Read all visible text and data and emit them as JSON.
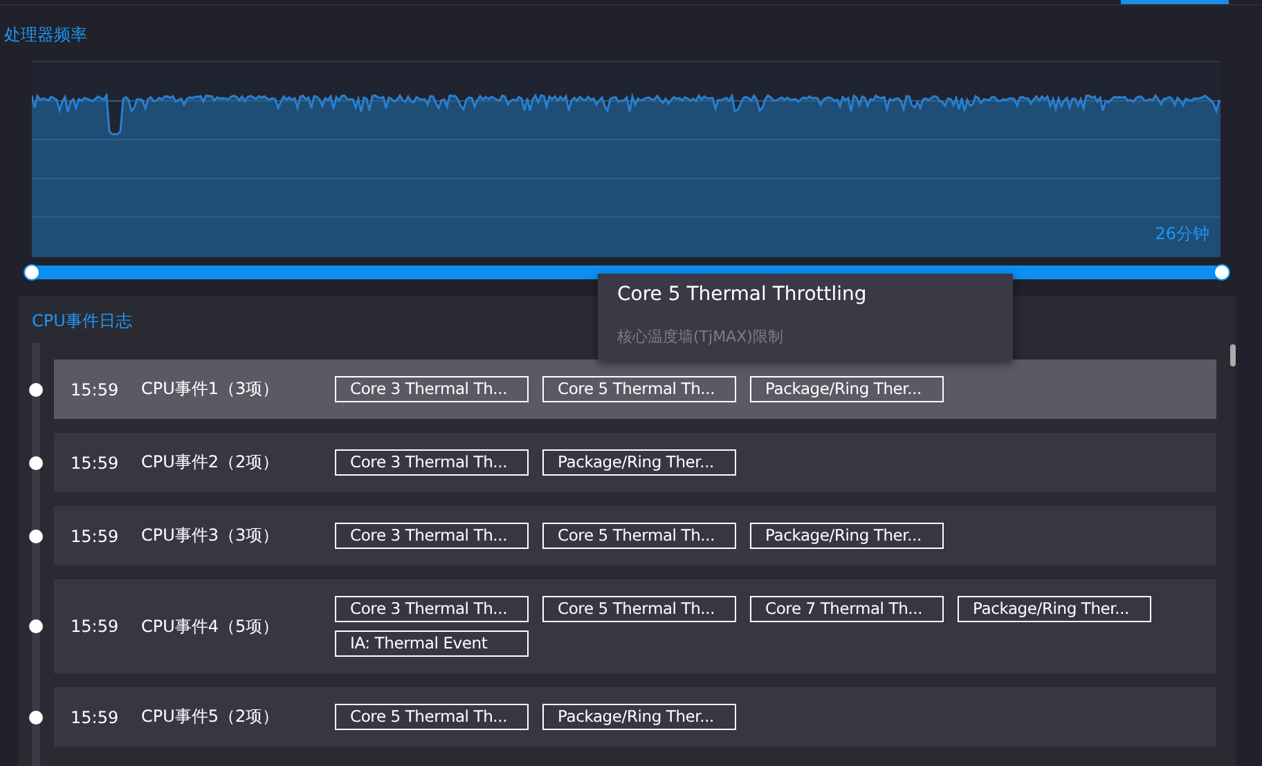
{
  "header": {
    "tab_indicator": true
  },
  "frequency": {
    "title": "处理器频率",
    "time_label": "26分钟",
    "range": {
      "level": 1
    }
  },
  "event_log": {
    "title": "CPU事件日志",
    "events": [
      {
        "time": "15:59",
        "name": "CPU事件1（3项）",
        "selected": true,
        "tags": [
          "Core 3 Thermal Th...",
          "Core 5 Thermal Th...",
          "Package/Ring Ther..."
        ]
      },
      {
        "time": "15:59",
        "name": "CPU事件2（2项）",
        "selected": false,
        "tags": [
          "Core 3 Thermal Th...",
          "Package/Ring Ther..."
        ]
      },
      {
        "time": "15:59",
        "name": "CPU事件3（3项）",
        "selected": false,
        "tags": [
          "Core 3 Thermal Th...",
          "Core 5 Thermal Th...",
          "Package/Ring Ther..."
        ]
      },
      {
        "time": "15:59",
        "name": "CPU事件4（5项）",
        "selected": false,
        "tags": [
          "Core 3 Thermal Th...",
          "Core 5 Thermal Th...",
          "Core 7 Thermal Th...",
          "Package/Ring Ther...",
          "IA: Thermal Event"
        ]
      },
      {
        "time": "15:59",
        "name": "CPU事件5（2项）",
        "selected": false,
        "tags": [
          "Core 5 Thermal Th...",
          "Package/Ring Ther..."
        ]
      }
    ]
  },
  "tooltip": {
    "title": "Core 5 Thermal Throttling",
    "description": "核心温度墙(TjMAX)限制"
  }
}
